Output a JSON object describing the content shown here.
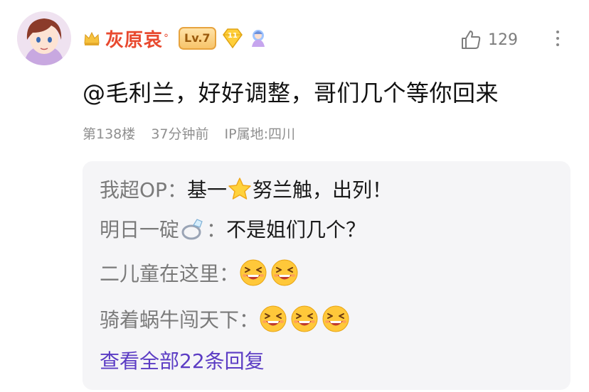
{
  "post": {
    "username": "灰原哀",
    "username_mark": "°",
    "level_badge": "Lv.7",
    "level_gem_number": "11",
    "like_count": "129",
    "content": "@毛利兰，好好调整，哥们几个等你回来",
    "floor": "第138楼",
    "time": "37分钟前",
    "ip_location": "IP属地:四川"
  },
  "replies": [
    {
      "author": "我超OP",
      "sep": "：",
      "text_before": "基一",
      "icon": "star-icon",
      "text_after": "努兰触，出列！"
    },
    {
      "author": "明日一碇",
      "icon": "ring-icon",
      "sep": "：",
      "text": "不是姐们几个？"
    },
    {
      "author": "二儿童在这里",
      "sep": "：",
      "emoji": "grinning-squint-face-icon",
      "emoji_count": 2
    },
    {
      "author": "骑着蜗牛闯天下",
      "sep": "：",
      "emoji": "grinning-squint-face-icon",
      "emoji_count": 3
    }
  ],
  "view_all": "查看全部22条回复",
  "colors": {
    "username": "#e8492f",
    "link": "#5b3cc4",
    "meta": "#8f8f8f",
    "reply_bg": "#f5f5f7"
  },
  "icons": {
    "avatar": "avatar-image",
    "crown": "crown-icon",
    "gem": "level-gem-icon",
    "fan_badge": "fan-badge-icon",
    "like": "thumbs-up-icon",
    "more": "more-vertical-icon"
  }
}
